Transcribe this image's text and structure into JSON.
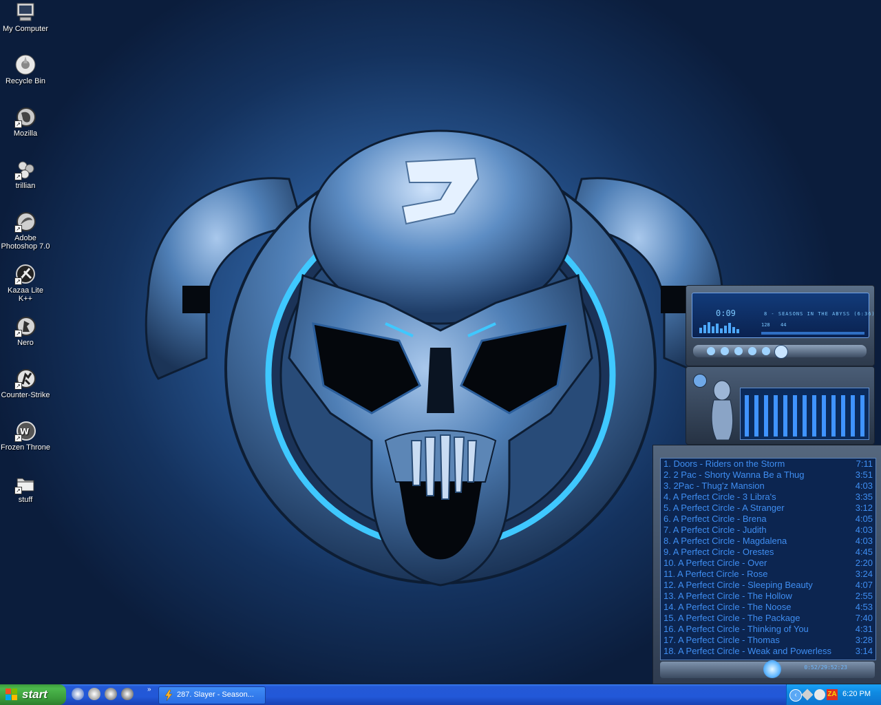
{
  "desktop_icons": [
    {
      "label": "My Computer",
      "icon": "my-computer-icon"
    },
    {
      "label": "Recycle Bin",
      "icon": "recycle-bin-icon"
    },
    {
      "label": "Mozilla",
      "icon": "mozilla-icon"
    },
    {
      "label": "trillian",
      "icon": "trillian-icon"
    },
    {
      "label": "Adobe Photoshop 7.0",
      "icon": "photoshop-icon"
    },
    {
      "label": "Kazaa Lite K++",
      "icon": "kazaa-icon"
    },
    {
      "label": "Nero",
      "icon": "nero-icon"
    },
    {
      "label": "Counter-Strike",
      "icon": "counter-strike-icon"
    },
    {
      "label": "Frozen Throne",
      "icon": "frozen-throne-icon"
    },
    {
      "label": "stuff",
      "icon": "folder-icon"
    }
  ],
  "player": {
    "time": "0:09",
    "ticker": "8 - SEASONS IN THE ABYSS (6:36)",
    "kbps": "128",
    "khz": "44"
  },
  "playlist": {
    "items": [
      {
        "title": "1.  Doors - Riders on the Storm",
        "length": "7:11"
      },
      {
        "title": "2. 2 Pac - Shorty Wanna Be a Thug",
        "length": "3:51"
      },
      {
        "title": "3. 2Pac - Thug'z Mansion",
        "length": "4:03"
      },
      {
        "title": "4. A Perfect Circle - 3 Libra's",
        "length": "3:35"
      },
      {
        "title": "5. A Perfect Circle - A Stranger",
        "length": "3:12"
      },
      {
        "title": "6. A Perfect Circle - Brena",
        "length": "4:05"
      },
      {
        "title": "7. A Perfect Circle - Judith",
        "length": "4:03"
      },
      {
        "title": "8. A Perfect Circle - Magdalena",
        "length": "4:03"
      },
      {
        "title": "9. A Perfect Circle - Orestes",
        "length": "4:45"
      },
      {
        "title": "10. A Perfect Circle - Over",
        "length": "2:20"
      },
      {
        "title": "11. A Perfect Circle - Rose",
        "length": "3:24"
      },
      {
        "title": "12. A Perfect Circle - Sleeping Beauty",
        "length": "4:07"
      },
      {
        "title": "13. A Perfect Circle - The Hollow",
        "length": "2:55"
      },
      {
        "title": "14. A Perfect Circle - The Noose",
        "length": "4:53"
      },
      {
        "title": "15. A Perfect Circle - The Package",
        "length": "7:40"
      },
      {
        "title": "16. A Perfect Circle - Thinking of You",
        "length": "4:31"
      },
      {
        "title": "17. A Perfect Circle - Thomas",
        "length": "3:28"
      },
      {
        "title": "18. A Perfect Circle - Weak and Powerless",
        "length": "3:14"
      }
    ],
    "footer_text": "0:52/29:52:23"
  },
  "taskbar": {
    "start_label": "start",
    "more_label": "»",
    "task_label": "287. Slayer - Season...",
    "clock": "6:20 PM"
  },
  "colors": {
    "playlist_text": "#3f8ef2",
    "taskbar_blue": "#2459d6",
    "start_green": "#3a9a3a"
  }
}
